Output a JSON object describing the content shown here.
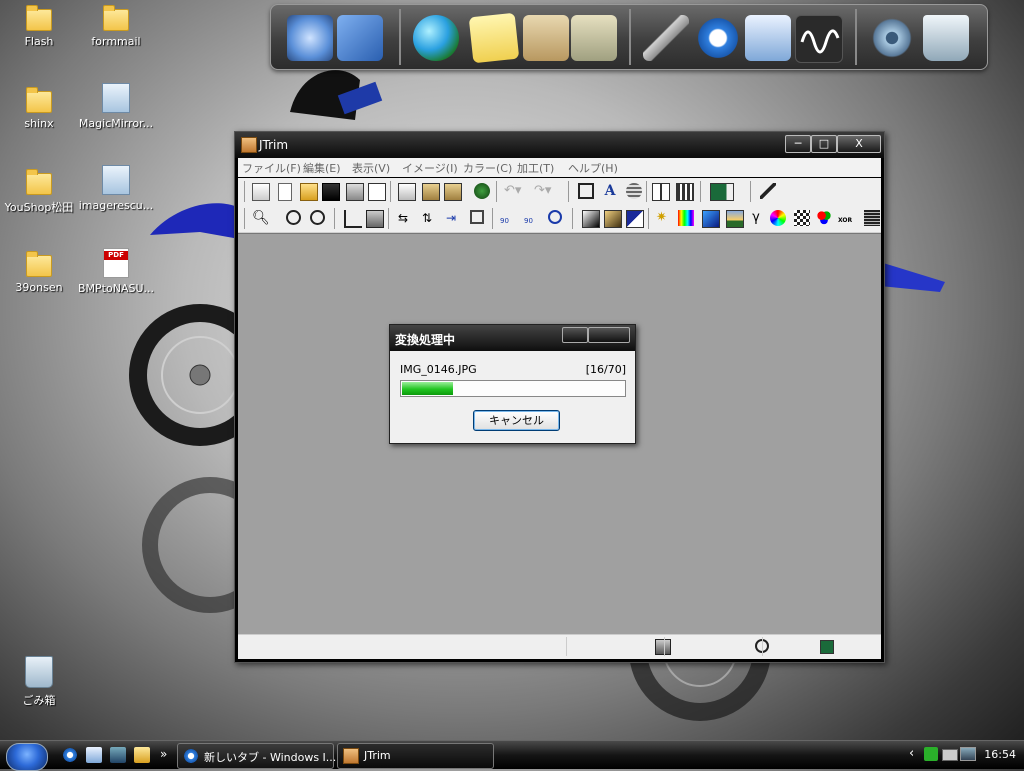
{
  "desktop": {
    "icons": [
      {
        "label": "Flash",
        "kind": "folder"
      },
      {
        "label": "formmail",
        "kind": "folder"
      },
      {
        "label": "shinx",
        "kind": "folder"
      },
      {
        "label": "MagicMirror...",
        "kind": "image-file"
      },
      {
        "label": "YouShop松田",
        "kind": "folder"
      },
      {
        "label": "imagerescu...",
        "kind": "image-file"
      },
      {
        "label": "39onsen",
        "kind": "folder"
      },
      {
        "label": "BMPtoNASU...",
        "kind": "pdf-file"
      },
      {
        "label": "ごみ箱",
        "kind": "recycle-bin"
      }
    ],
    "pdf_badge": "PDF"
  },
  "dock": {
    "items": [
      "computer-icon",
      "network-icon",
      "globe-icon",
      "notes-icon",
      "photo-folder-icon",
      "file-cabinet-icon",
      "wrench-icon",
      "internet-explorer-icon",
      "mail-icon",
      "wave-app-icon",
      "settings-gear-icon",
      "recycle-bin-icon"
    ]
  },
  "window": {
    "title": "JTrim",
    "controls": {
      "minimize": "─",
      "maximize": "□",
      "close": "X"
    },
    "menu": [
      "ファイル(F)",
      "編集(E)",
      "表示(V)",
      "イメージ(I)",
      "カラー(C)",
      "加工(T)",
      "ヘルプ(H)"
    ],
    "toolbar1": [
      "new-window-icon",
      "new-file-icon",
      "open-icon",
      "save-icon",
      "print-icon",
      "print-preview-icon",
      "copy-icon",
      "paste-icon",
      "paste-new-icon",
      "capture-icon",
      "undo-icon",
      "redo-icon",
      "fit-icon",
      "text-icon",
      "lines-icon",
      "grid-view-icon",
      "filmstrip-icon",
      "mosaic-icon",
      "eyedropper-icon"
    ],
    "toolbar2": [
      "zoom-icon",
      "zoom-in-icon",
      "zoom-out-icon",
      "crop-icon",
      "resize-icon",
      "flip-horizontal-icon",
      "flip-vertical-icon",
      "split-icon",
      "frame-icon",
      "rotate-left-90-icon",
      "rotate-right-90-icon",
      "rotate-free-icon",
      "grayscale-icon",
      "sepia-icon",
      "negative-icon",
      "sparkle-icon",
      "color-bars-icon",
      "contrast-icon",
      "landscape-icon",
      "gamma-icon",
      "color-wheel-icon",
      "checker-icon",
      "rgb-icon",
      "xor-icon",
      "gradient-icon"
    ],
    "gamma_glyph": "γ",
    "text_glyph": "A",
    "xor_label": "XOR",
    "rot_label_left": "90",
    "rot_label_right": "90"
  },
  "progress_dialog": {
    "title": "変換処理中",
    "filename": "IMG_0146.JPG",
    "counter": "[16/70]",
    "progress_fraction": 0.23,
    "cancel_label": "キャンセル"
  },
  "taskbar": {
    "quick_launch": [
      "ie-icon",
      "mail-icon",
      "desktop-icon",
      "folder-icon"
    ],
    "more": "»",
    "tasks": [
      {
        "label": "新しいタブ - Windows I...",
        "icon": "ie-icon"
      },
      {
        "label": "JTrim",
        "icon": "jtrim-icon"
      }
    ],
    "tray_arrow": "‹",
    "clock": "16:54"
  },
  "colors": {
    "progress_green": "#21c521",
    "title_bar": "#0a0a0a",
    "canvas_gray": "#a0a0a0"
  }
}
